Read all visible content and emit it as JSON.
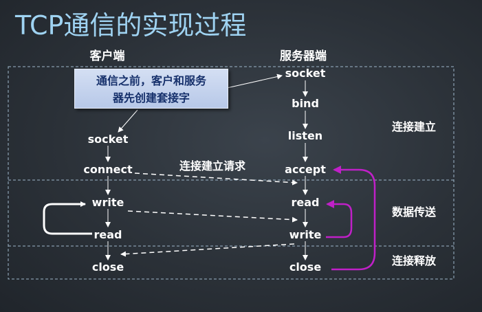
{
  "title": "TCP通信的实现过程",
  "client_header": "客户端",
  "server_header": "服务器端",
  "callout": {
    "line1": "通信之前，客户和服务",
    "line2": "器先创建套接字"
  },
  "client_steps": {
    "socket": "socket",
    "connect": "connect",
    "write": "write",
    "read": "read",
    "close": "close"
  },
  "server_steps": {
    "socket": "socket",
    "bind": "bind",
    "listen": "listen",
    "accept": "accept",
    "read": "read",
    "write": "write",
    "close": "close"
  },
  "connect_request": "连接建立请求",
  "phases": {
    "establish": "连接建立",
    "transfer": "数据传送",
    "release": "连接释放"
  },
  "colors": {
    "title": "#9fd3f2",
    "loop": "#c020c8",
    "callout_text": "#16306b",
    "dash_frame": "#9fb8cc"
  }
}
